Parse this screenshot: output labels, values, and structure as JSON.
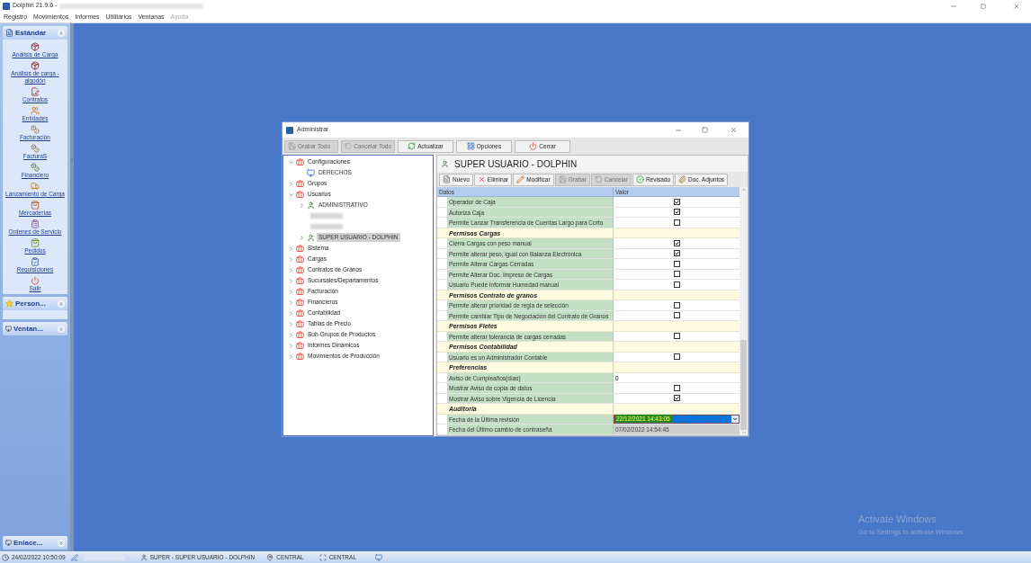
{
  "app": {
    "title": "Dolphin 21.9.6 -",
    "menu": [
      "Registro",
      "Movimientos",
      "Informes",
      "Utilitários",
      "Ventanas",
      "Ayuda"
    ]
  },
  "sidebar": {
    "panels": [
      {
        "title": "Estándar",
        "expanded": true,
        "items": [
          "Análisis de Carga",
          "Análisis de carga - algodón",
          "Contratos",
          "Entidades",
          "Facturación",
          "FacturaS",
          "Financiero",
          "Lanzamiento de Carga",
          "Mercaderías",
          "Ordenes de Servicio",
          "Pedidos",
          "Requisiciones",
          "Salir"
        ]
      },
      {
        "title": "Person...",
        "expanded": true
      },
      {
        "title": "Ventan...",
        "expanded": false
      }
    ],
    "bottom_panel": {
      "title": "Enlace..."
    }
  },
  "window": {
    "title": "Administrar",
    "toolbar": [
      {
        "label": "Grabar Todo",
        "disabled": true
      },
      {
        "label": "Cancelar Todo",
        "disabled": true
      },
      {
        "label": "Actualizar",
        "disabled": false
      },
      {
        "label": "Opciones",
        "disabled": false
      },
      {
        "label": "Cerrar",
        "disabled": false
      }
    ],
    "tree": [
      {
        "label": "Configuraciones",
        "kind": "group",
        "expanded": true,
        "selected": false,
        "children": [
          {
            "label": "DERECHOS",
            "kind": "rights",
            "selected": false
          }
        ]
      },
      {
        "label": "Grupos",
        "kind": "group",
        "expanded": false,
        "selected": false
      },
      {
        "label": "Usuarios",
        "kind": "group",
        "expanded": true,
        "selected": false,
        "children": [
          {
            "label": "ADMINISTRATIVO",
            "kind": "user",
            "selected": false
          },
          {
            "kind": "redacted"
          },
          {
            "kind": "redacted"
          },
          {
            "label": "SUPER USUARIO - DOLPHIN",
            "kind": "user",
            "selected": true
          }
        ]
      },
      {
        "label": "Sistema",
        "kind": "group",
        "expanded": false,
        "selected": false
      },
      {
        "label": "Cargas",
        "kind": "group",
        "expanded": false,
        "selected": false
      },
      {
        "label": "Contratos de Granos",
        "kind": "group",
        "expanded": false,
        "selected": false
      },
      {
        "label": "Sucursales/Departamentos",
        "kind": "group",
        "expanded": false,
        "selected": false
      },
      {
        "label": "Facturación",
        "kind": "group",
        "expanded": false,
        "selected": false
      },
      {
        "label": "Financieros",
        "kind": "group",
        "expanded": false,
        "selected": false
      },
      {
        "label": "Contabilidad",
        "kind": "group",
        "expanded": false,
        "selected": false
      },
      {
        "label": "Tablas de Precio",
        "kind": "group",
        "expanded": false,
        "selected": false
      },
      {
        "label": "Sub-Grupos de Productos",
        "kind": "group",
        "expanded": false,
        "selected": false
      },
      {
        "label": "Informes Dinámicos",
        "kind": "group",
        "expanded": false,
        "selected": false
      },
      {
        "label": "Movimientos de Producción",
        "kind": "group",
        "expanded": false,
        "selected": false
      }
    ],
    "detail": {
      "title": "SUPER USUARIO - DOLPHIN",
      "toolbar": [
        {
          "label": "Nuevo",
          "disabled": false
        },
        {
          "label": "Eliminar",
          "disabled": false
        },
        {
          "label": "Modificar",
          "disabled": false
        },
        {
          "label": "Grabar",
          "disabled": true
        },
        {
          "label": "Cancelar",
          "disabled": true
        },
        {
          "label": "Revisado",
          "disabled": false
        },
        {
          "label": "Doc. Adjuntos",
          "disabled": false
        }
      ],
      "columns": [
        "Datos",
        "Valor"
      ],
      "rows": [
        {
          "kind": "check",
          "label": "Operador de Caja",
          "checked": true
        },
        {
          "kind": "check",
          "label": "Autoriza Caja",
          "checked": true
        },
        {
          "kind": "check",
          "label": "Permite Lanzar Transferencia de Cuentas Largo para Corto",
          "checked": false
        },
        {
          "kind": "section",
          "label": "Permisos Cargas"
        },
        {
          "kind": "check",
          "label": "Cierra Cargas con peso manual",
          "checked": true
        },
        {
          "kind": "check",
          "label": "Permite alterar peso, igual con Balanza Electrónica",
          "checked": true
        },
        {
          "kind": "check",
          "label": "Permite Alterar Cargas Cerradas",
          "checked": false
        },
        {
          "kind": "check",
          "label": "Permite Alterar Doc. Impreso de Cargas",
          "checked": false
        },
        {
          "kind": "check",
          "label": "Usuario Puede Informar Humedad manual",
          "checked": false
        },
        {
          "kind": "section",
          "label": "Permisos Contrato de granos"
        },
        {
          "kind": "check",
          "label": "Permite alterar prioridad de regla de selección",
          "checked": false
        },
        {
          "kind": "check",
          "label": "Permite cambiar Tipo de Negociación del Contrato de Granos",
          "checked": false
        },
        {
          "kind": "section",
          "label": "Permisos Fletes"
        },
        {
          "kind": "check",
          "label": "Permite alterar tolerancia de cargas cerradas",
          "checked": false
        },
        {
          "kind": "section",
          "label": "Permisos Contabilidad"
        },
        {
          "kind": "check",
          "label": "Usuario es un Administrador Contable",
          "checked": false
        },
        {
          "kind": "section",
          "label": "Preferencias"
        },
        {
          "kind": "text",
          "label": "Aviso de Cumpleaños(días)",
          "value": "0"
        },
        {
          "kind": "check",
          "label": "Mostrar Aviso de copia de datos",
          "checked": false
        },
        {
          "kind": "check",
          "label": "Mostrar Aviso sobre Vigencia de Licencia",
          "checked": true
        },
        {
          "kind": "section",
          "label": "Auditoria"
        },
        {
          "kind": "dropdown",
          "label": "Fecha de la Última revisión",
          "value": "22/12/2021 14:43:05"
        },
        {
          "kind": "readonly",
          "label": "Fecha del Último cambio de contraseña",
          "value": "07/02/2022 14:54:45"
        }
      ]
    }
  },
  "watermark": {
    "title": "Activate Windows",
    "subtitle": "Go to Settings to activate Windows."
  },
  "status_bar": {
    "datetime": "24/02/2022 10:50:09",
    "user": "SUPER - SUPER USUARIO - DOLPHIN",
    "location": "CENTRAL",
    "branch": "CENTRAL"
  }
}
